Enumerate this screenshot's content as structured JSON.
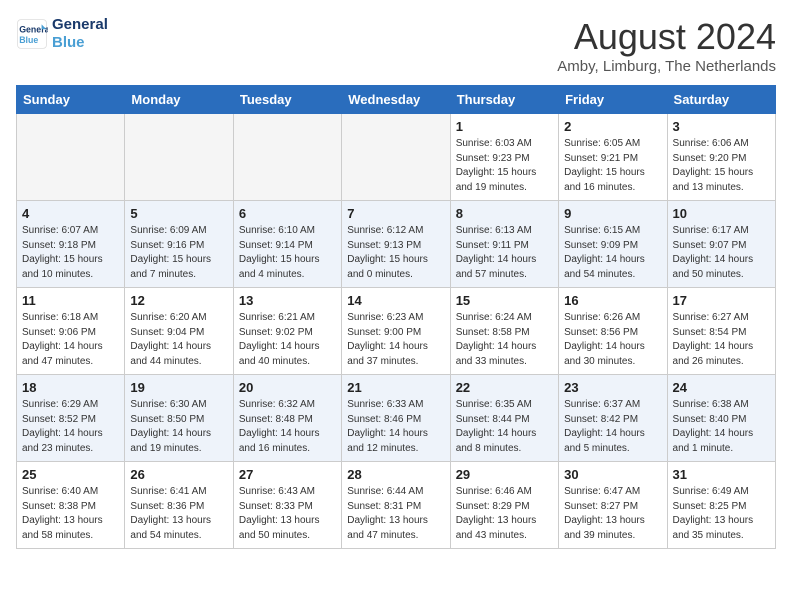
{
  "header": {
    "logo_line1": "General",
    "logo_line2": "Blue",
    "month_year": "August 2024",
    "location": "Amby, Limburg, The Netherlands"
  },
  "weekdays": [
    "Sunday",
    "Monday",
    "Tuesday",
    "Wednesday",
    "Thursday",
    "Friday",
    "Saturday"
  ],
  "weeks": [
    [
      {
        "day": "",
        "empty": true
      },
      {
        "day": "",
        "empty": true
      },
      {
        "day": "",
        "empty": true
      },
      {
        "day": "",
        "empty": true
      },
      {
        "day": "1",
        "sunrise": "6:03 AM",
        "sunset": "9:23 PM",
        "daylight": "15 hours and 19 minutes."
      },
      {
        "day": "2",
        "sunrise": "6:05 AM",
        "sunset": "9:21 PM",
        "daylight": "15 hours and 16 minutes."
      },
      {
        "day": "3",
        "sunrise": "6:06 AM",
        "sunset": "9:20 PM",
        "daylight": "15 hours and 13 minutes."
      }
    ],
    [
      {
        "day": "4",
        "sunrise": "6:07 AM",
        "sunset": "9:18 PM",
        "daylight": "15 hours and 10 minutes."
      },
      {
        "day": "5",
        "sunrise": "6:09 AM",
        "sunset": "9:16 PM",
        "daylight": "15 hours and 7 minutes."
      },
      {
        "day": "6",
        "sunrise": "6:10 AM",
        "sunset": "9:14 PM",
        "daylight": "15 hours and 4 minutes."
      },
      {
        "day": "7",
        "sunrise": "6:12 AM",
        "sunset": "9:13 PM",
        "daylight": "15 hours and 0 minutes."
      },
      {
        "day": "8",
        "sunrise": "6:13 AM",
        "sunset": "9:11 PM",
        "daylight": "14 hours and 57 minutes."
      },
      {
        "day": "9",
        "sunrise": "6:15 AM",
        "sunset": "9:09 PM",
        "daylight": "14 hours and 54 minutes."
      },
      {
        "day": "10",
        "sunrise": "6:17 AM",
        "sunset": "9:07 PM",
        "daylight": "14 hours and 50 minutes."
      }
    ],
    [
      {
        "day": "11",
        "sunrise": "6:18 AM",
        "sunset": "9:06 PM",
        "daylight": "14 hours and 47 minutes."
      },
      {
        "day": "12",
        "sunrise": "6:20 AM",
        "sunset": "9:04 PM",
        "daylight": "14 hours and 44 minutes."
      },
      {
        "day": "13",
        "sunrise": "6:21 AM",
        "sunset": "9:02 PM",
        "daylight": "14 hours and 40 minutes."
      },
      {
        "day": "14",
        "sunrise": "6:23 AM",
        "sunset": "9:00 PM",
        "daylight": "14 hours and 37 minutes."
      },
      {
        "day": "15",
        "sunrise": "6:24 AM",
        "sunset": "8:58 PM",
        "daylight": "14 hours and 33 minutes."
      },
      {
        "day": "16",
        "sunrise": "6:26 AM",
        "sunset": "8:56 PM",
        "daylight": "14 hours and 30 minutes."
      },
      {
        "day": "17",
        "sunrise": "6:27 AM",
        "sunset": "8:54 PM",
        "daylight": "14 hours and 26 minutes."
      }
    ],
    [
      {
        "day": "18",
        "sunrise": "6:29 AM",
        "sunset": "8:52 PM",
        "daylight": "14 hours and 23 minutes."
      },
      {
        "day": "19",
        "sunrise": "6:30 AM",
        "sunset": "8:50 PM",
        "daylight": "14 hours and 19 minutes."
      },
      {
        "day": "20",
        "sunrise": "6:32 AM",
        "sunset": "8:48 PM",
        "daylight": "14 hours and 16 minutes."
      },
      {
        "day": "21",
        "sunrise": "6:33 AM",
        "sunset": "8:46 PM",
        "daylight": "14 hours and 12 minutes."
      },
      {
        "day": "22",
        "sunrise": "6:35 AM",
        "sunset": "8:44 PM",
        "daylight": "14 hours and 8 minutes."
      },
      {
        "day": "23",
        "sunrise": "6:37 AM",
        "sunset": "8:42 PM",
        "daylight": "14 hours and 5 minutes."
      },
      {
        "day": "24",
        "sunrise": "6:38 AM",
        "sunset": "8:40 PM",
        "daylight": "14 hours and 1 minute."
      }
    ],
    [
      {
        "day": "25",
        "sunrise": "6:40 AM",
        "sunset": "8:38 PM",
        "daylight": "13 hours and 58 minutes."
      },
      {
        "day": "26",
        "sunrise": "6:41 AM",
        "sunset": "8:36 PM",
        "daylight": "13 hours and 54 minutes."
      },
      {
        "day": "27",
        "sunrise": "6:43 AM",
        "sunset": "8:33 PM",
        "daylight": "13 hours and 50 minutes."
      },
      {
        "day": "28",
        "sunrise": "6:44 AM",
        "sunset": "8:31 PM",
        "daylight": "13 hours and 47 minutes."
      },
      {
        "day": "29",
        "sunrise": "6:46 AM",
        "sunset": "8:29 PM",
        "daylight": "13 hours and 43 minutes."
      },
      {
        "day": "30",
        "sunrise": "6:47 AM",
        "sunset": "8:27 PM",
        "daylight": "13 hours and 39 minutes."
      },
      {
        "day": "31",
        "sunrise": "6:49 AM",
        "sunset": "8:25 PM",
        "daylight": "13 hours and 35 minutes."
      }
    ]
  ]
}
